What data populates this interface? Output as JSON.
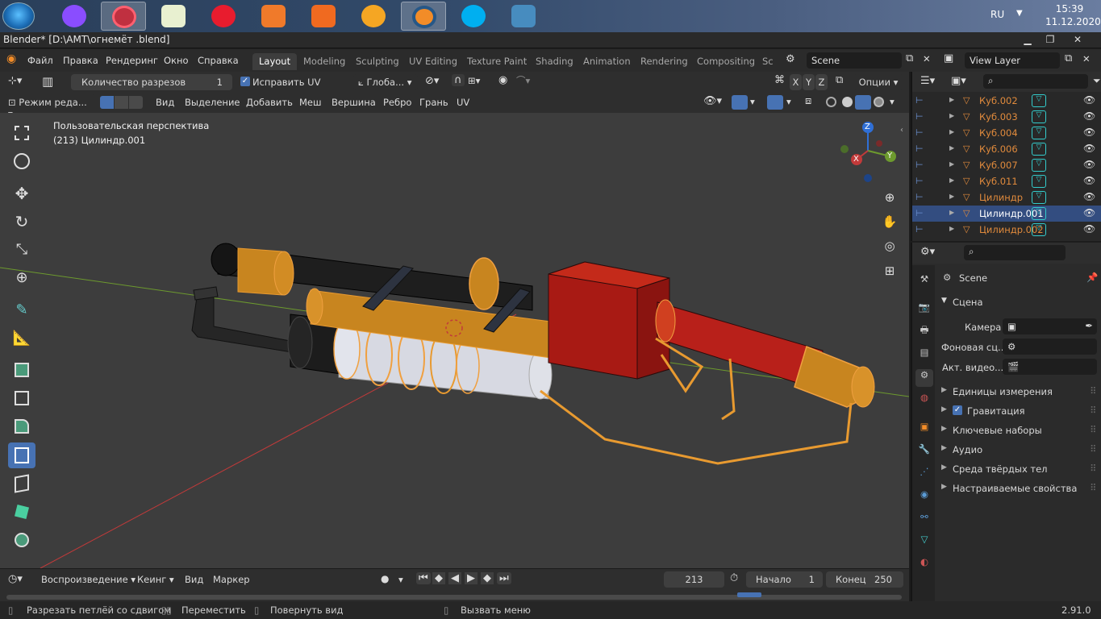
{
  "taskbar": {
    "lang": "RU",
    "time": "15:39",
    "date": "11.12.2020"
  },
  "window": {
    "title": "Blender* [D:\\AMT\\огнемёт .blend]"
  },
  "menu": [
    "Файл",
    "Правка",
    "Рендеринг",
    "Окно",
    "Справка"
  ],
  "workspaces": [
    "Layout",
    "Modeling",
    "Sculpting",
    "UV Editing",
    "Texture Paint",
    "Shading",
    "Animation",
    "Rendering",
    "Compositing",
    "Sc"
  ],
  "scene": {
    "name": "Scene"
  },
  "view_layer": {
    "name": "View Layer"
  },
  "tool_header": {
    "cuts_label": "Количество разрезов",
    "cuts_value": "1",
    "correct_uv": "Исправить UV",
    "orientation": "Глоба...",
    "axes": [
      "X",
      "Y",
      "Z"
    ],
    "options": "Опции"
  },
  "view_header": {
    "mode": "Режим реда...",
    "items": [
      "Вид",
      "Выделение",
      "Добавить",
      "Меш",
      "Вершина",
      "Ребро",
      "Грань",
      "UV"
    ]
  },
  "viewport": {
    "perspective": "Пользовательская перспектива",
    "object": "(213) Цилиндр.001",
    "gizmo": {
      "z": "Z",
      "y": "Y",
      "x": "X"
    }
  },
  "timeline": {
    "playback": "Воспроизведение",
    "keying": "Кеинг",
    "view": "Вид",
    "marker": "Маркер",
    "current_frame": "213",
    "start_label": "Начало",
    "start": "1",
    "end_label": "Конец",
    "end": "250"
  },
  "status": {
    "item1": "Разрезать петлёй со сдвигом",
    "item2": "Переместить",
    "item3": "Повернуть вид",
    "item4": "Вызвать меню",
    "version": "2.91.0"
  },
  "outliner": {
    "items": [
      {
        "name": "Куб.002",
        "selected": false
      },
      {
        "name": "Куб.003",
        "selected": false
      },
      {
        "name": "Куб.004",
        "selected": false
      },
      {
        "name": "Куб.006",
        "selected": false
      },
      {
        "name": "Куб.007",
        "selected": false
      },
      {
        "name": "Куб.011",
        "selected": false
      },
      {
        "name": "Цилиндр",
        "selected": false
      },
      {
        "name": "Цилиндр.001",
        "selected": true
      },
      {
        "name": "Цилиндр.002",
        "selected": false
      }
    ]
  },
  "properties": {
    "context": "Scene",
    "section": "Сцена",
    "camera_label": "Камера",
    "background_label": "Фоновая сц...",
    "active_clip_label": "Акт. видео...",
    "panels": [
      "Единицы измерения",
      "Гравитация",
      "Ключевые наборы",
      "Аудио",
      "Среда твёрдых тел",
      "Настраиваемые свойства"
    ]
  },
  "colors": {
    "accent": "#4772b3",
    "selection_orange": "#e08a3c",
    "viewport_bg": "#3d3d3d",
    "x_axis": "#c23a3a",
    "y_axis": "#6d9a2e",
    "z_axis": "#2f6fd6"
  }
}
